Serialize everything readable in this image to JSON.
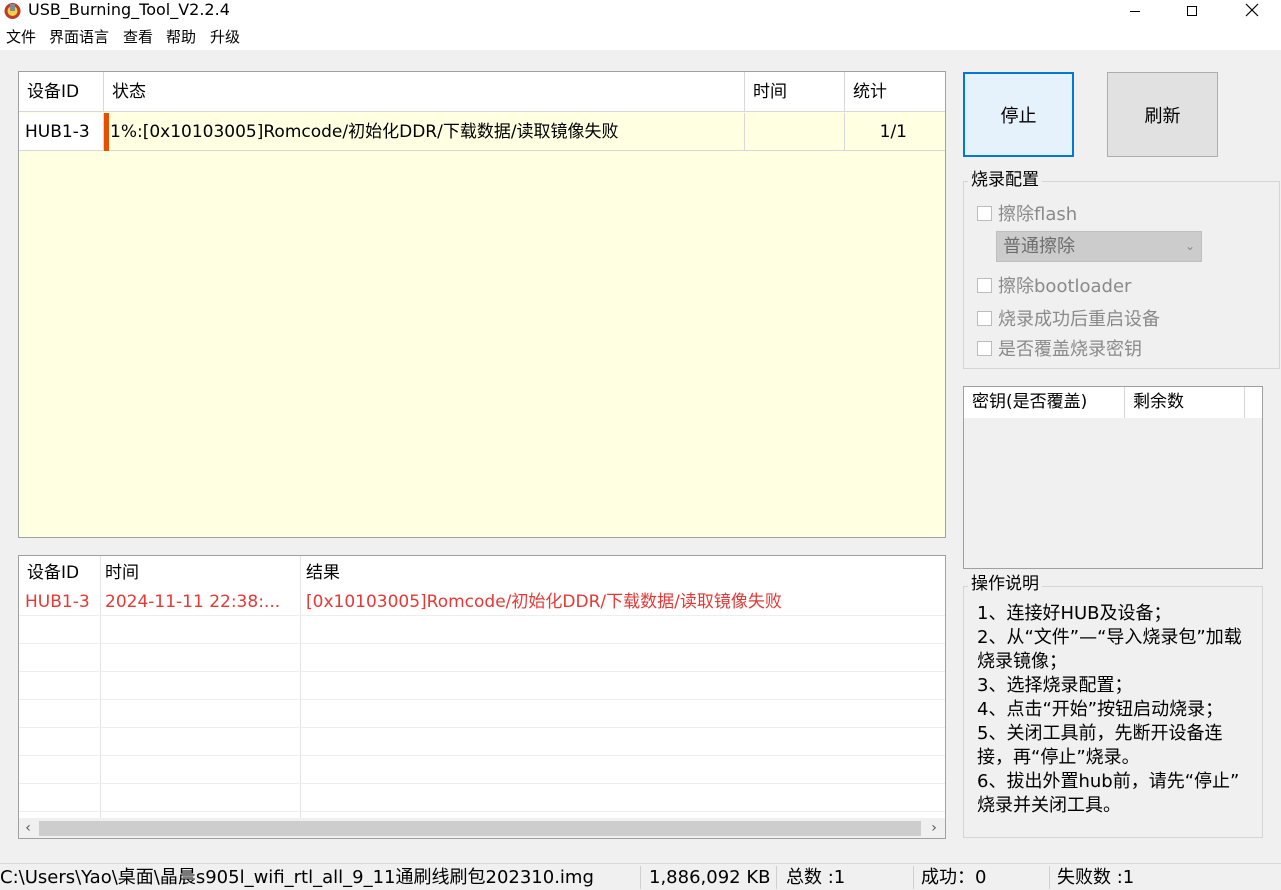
{
  "window": {
    "title": "USB_Burning_Tool_V2.2.4",
    "icon": "usb-tool-app-icon",
    "controls": {
      "minimize": "minimize-icon",
      "maximize": "maximize-icon",
      "close": "close-icon"
    }
  },
  "menu": [
    "文件",
    "界面语言",
    "查看",
    "帮助",
    "升级"
  ],
  "device_table": {
    "headers": {
      "device_id": "设备ID",
      "status": "状态",
      "time": "时间",
      "stats": "统计"
    },
    "rows": [
      {
        "device_id": "HUB1-3",
        "status": "1%:[0x10103005]Romcode/初始化DDR/下载数据/读取镜像失败",
        "time": "",
        "stats": "1/1",
        "progress_percent": 1
      }
    ]
  },
  "log_table": {
    "headers": {
      "device_id": "设备ID",
      "time": "时间",
      "result": "结果"
    },
    "rows": [
      {
        "device_id": "HUB1-3",
        "time": "2024-11-11 22:38:...",
        "result": "[0x10103005]Romcode/初始化DDR/下载数据/读取镜像失败"
      }
    ]
  },
  "buttons": {
    "stop": "停止",
    "refresh": "刷新"
  },
  "burn_config": {
    "title": "烧录配置",
    "erase_flash": "擦除flash",
    "erase_mode": "普通擦除",
    "erase_bootloader": "擦除bootloader",
    "reboot_after_success": "烧录成功后重启设备",
    "overwrite_key": "是否覆盖烧录密钥"
  },
  "key_table": {
    "headers": {
      "key": "密钥(是否覆盖)",
      "remaining": "剩余数"
    }
  },
  "instructions": {
    "title": "操作说明",
    "lines": [
      "1、连接好HUB及设备；",
      "2、从“文件”—“导入烧录包”加载",
      "烧录镜像；",
      "3、选择烧录配置；",
      "4、点击“开始”按钮启动烧录；",
      "5、关闭工具前，先断开设备连",
      "接，再“停止”烧录。",
      "6、拔出外置hub前，请先“停止”",
      "烧录并关闭工具。"
    ]
  },
  "status_bar": {
    "path": "C:\\Users\\Yao\\桌面\\晶晨s905l_wifi_rtl_all_9_11通刷线刷包202310.img",
    "size": "1,886,092 KB",
    "total": "总数 :1",
    "success": "成功：0",
    "fail": "失败数 :1"
  },
  "colors": {
    "table_bg": "#ffffe1",
    "error_text": "#e53935",
    "progress": "#e65100",
    "focus_border": "#0078d7"
  }
}
